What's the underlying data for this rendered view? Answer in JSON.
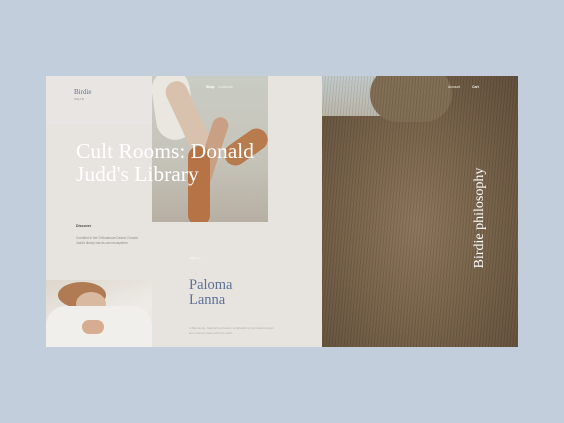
{
  "brand": {
    "name": "Birdie",
    "tagline": "WEAR"
  },
  "nav": {
    "home": "Shop",
    "lookbook": "Lookbook",
    "account": "Account",
    "cart": "Cart"
  },
  "hero": {
    "headline_line1": "Cult Rooms: Donald",
    "headline_line2": "Judd's Library",
    "discover_label": "Discover",
    "discover_desc": "Cornified in the Chihuahuan Desert, Donald Judd's library has its own ecosystem."
  },
  "feature": {
    "link": "Meet us",
    "name_line1": "Paloma",
    "name_line2": "Lanna",
    "desc": "A Barcelona, Spanish recreation emphasizing minimalist design. Her interest chaos with the earth."
  },
  "side": {
    "philosophy": "Birdie philosophy"
  }
}
